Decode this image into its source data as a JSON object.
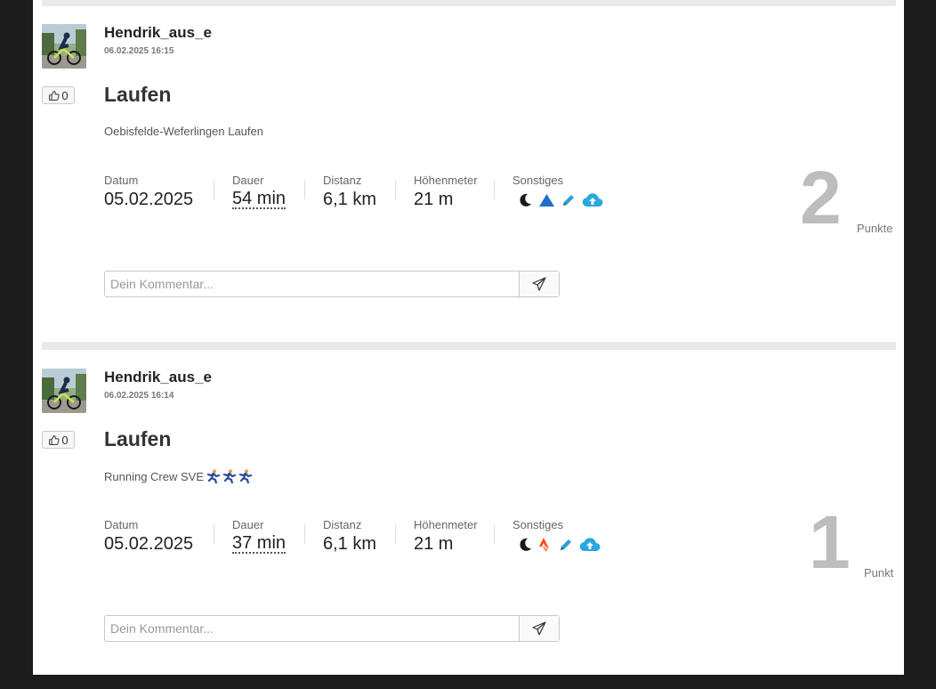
{
  "posts": [
    {
      "username": "Hendrik_aus_e",
      "timestamp": "06.02.2025 16:15",
      "likes": "0",
      "title": "Laufen",
      "description": "Oebisfelde-Weferlingen Laufen",
      "description_emoji": [],
      "stats": {
        "datum_label": "Datum",
        "datum_value": "05.02.2025",
        "dauer_label": "Dauer",
        "dauer_value": "54 min",
        "distanz_label": "Distanz",
        "distanz_value": "6,1 km",
        "hoehe_label": "Höhenmeter",
        "hoehe_value": "21 m",
        "sonstiges_label": "Sonstiges"
      },
      "other_icons": [
        "moon-icon",
        "triangle-icon",
        "pencil-icon",
        "cloud-upload-icon"
      ],
      "points": "2",
      "points_label": "Punkte",
      "comment_placeholder": "Dein Kommentar..."
    },
    {
      "username": "Hendrik_aus_e",
      "timestamp": "06.02.2025 16:14",
      "likes": "0",
      "title": "Laufen",
      "description": "Running Crew SVE",
      "description_emoji": [
        "runner-emoji",
        "runner-emoji",
        "runner-emoji"
      ],
      "stats": {
        "datum_label": "Datum",
        "datum_value": "05.02.2025",
        "dauer_label": "Dauer",
        "dauer_value": "37 min",
        "distanz_label": "Distanz",
        "distanz_value": "6,1 km",
        "hoehe_label": "Höhenmeter",
        "hoehe_value": "21 m",
        "sonstiges_label": "Sonstiges"
      },
      "other_icons": [
        "moon-icon",
        "strava-icon",
        "pencil-icon",
        "cloud-upload-icon"
      ],
      "points": "1",
      "points_label": "Punkt",
      "comment_placeholder": "Dein Kommentar..."
    }
  ],
  "colors": {
    "background": "#1c1c1c",
    "card": "#ffffff",
    "divider": "#e9e9e9",
    "points": "#bdbdbd",
    "triangle_blue": "#1f6fc5",
    "strava_orange": "#fc4c02",
    "pencil_blue": "#2a9fd8",
    "cloud_blue": "#29a8e0"
  }
}
